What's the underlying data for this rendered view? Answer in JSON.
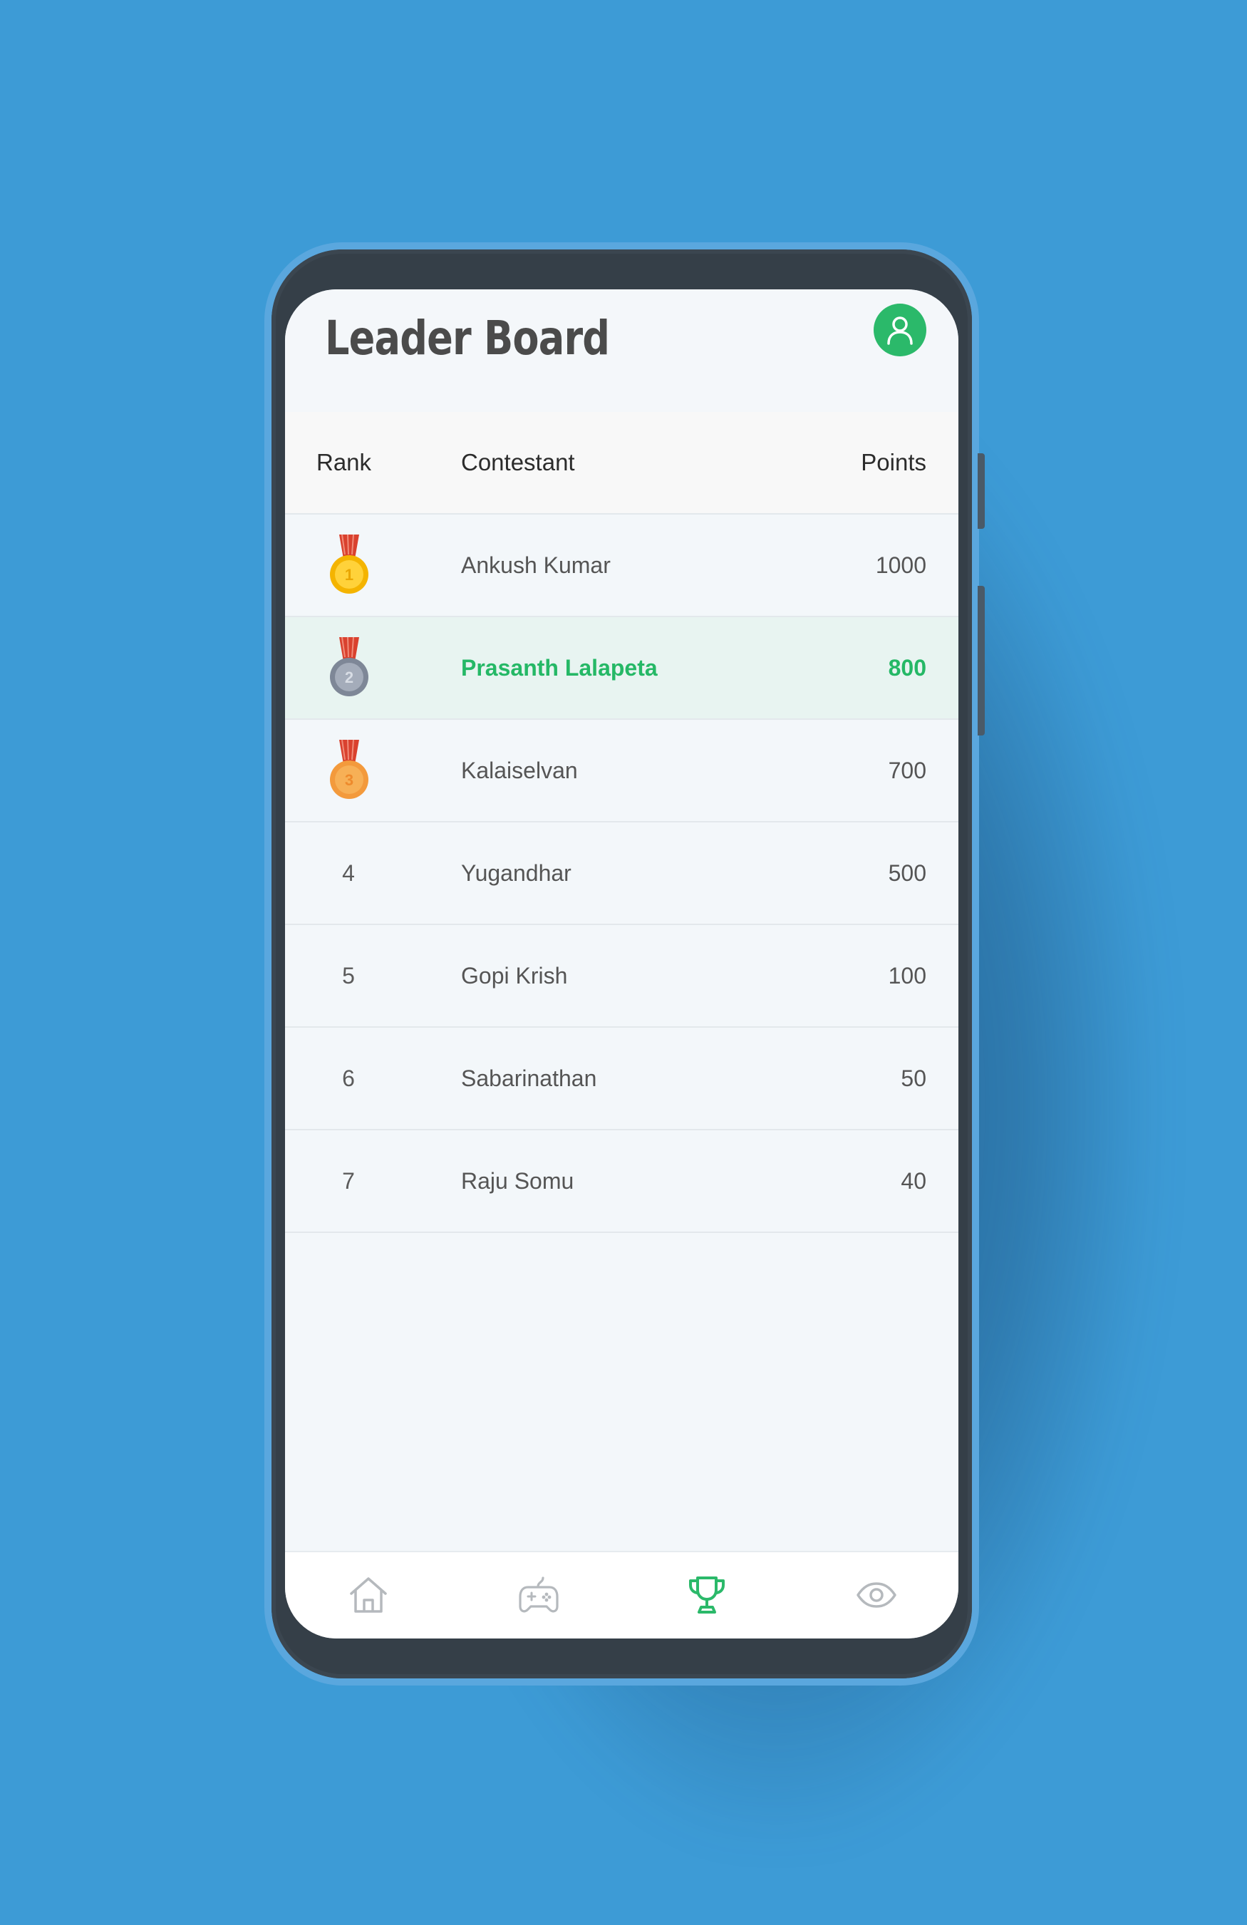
{
  "app": {
    "title": "Leader Board"
  },
  "colors": {
    "accent": "#2bb96a",
    "highlight_text": "#25b866",
    "background": "#3d9bd6"
  },
  "header": {
    "profile_icon": "user-icon"
  },
  "table": {
    "columns": {
      "rank": "Rank",
      "contestant": "Contestant",
      "points": "Points"
    },
    "rows": [
      {
        "rank": "1",
        "medal": "gold-medal-icon",
        "name": "Ankush Kumar",
        "points": "1000"
      },
      {
        "rank": "2",
        "medal": "silver-medal-icon",
        "name": "Prasanth Lalapeta",
        "points": "800",
        "highlighted": true
      },
      {
        "rank": "3",
        "medal": "bronze-medal-icon",
        "name": "Kalaiselvan",
        "points": "700"
      },
      {
        "rank": "4",
        "name": "Yugandhar",
        "points": "500"
      },
      {
        "rank": "5",
        "name": "Gopi Krish",
        "points": "100"
      },
      {
        "rank": "6",
        "name": "Sabarinathan",
        "points": "50"
      },
      {
        "rank": "7",
        "name": "Raju Somu",
        "points": "40"
      }
    ]
  },
  "bottom_nav": [
    {
      "icon": "home-icon",
      "active": false
    },
    {
      "icon": "gamepad-icon",
      "active": false
    },
    {
      "icon": "trophy-icon",
      "active": true
    },
    {
      "icon": "eye-icon",
      "active": false
    }
  ]
}
